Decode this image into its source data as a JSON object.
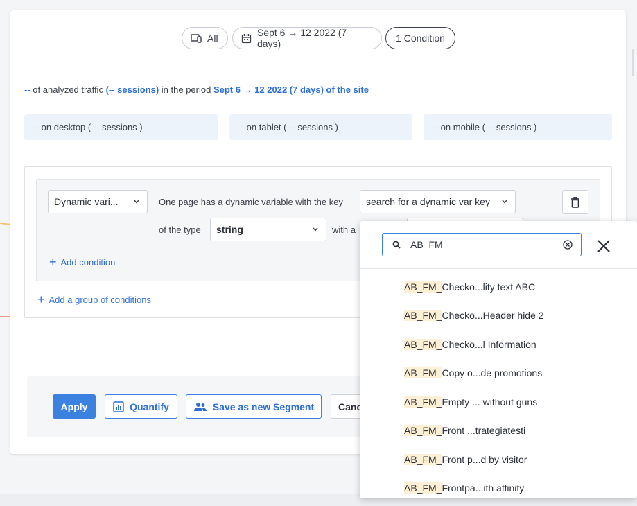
{
  "filters": {
    "device_label": "All",
    "date_label": "Sept 6 → 12 2022 (7 days)",
    "condition_label": "1 Condition"
  },
  "summary": {
    "count": "--",
    "text1": "of analyzed traffic",
    "sessions": "(-- sessions)",
    "text2": "in the period",
    "period": "Sept 6 → 12 2022 (7 days) of the site"
  },
  "devices": [
    {
      "count": "--",
      "label": "on desktop ( -- sessions )"
    },
    {
      "count": "--",
      "label": "on tablet ( -- sessions )"
    },
    {
      "count": "--",
      "label": "on mobile ( -- sessions )"
    }
  ],
  "condition": {
    "type_select": "Dynamic vari...",
    "sentence1": "One page has a dynamic variable with the key",
    "key_select": "search for a dynamic var key",
    "sentence2": "of the type",
    "type_value": "string",
    "sentence3": "with a",
    "add_condition": "Add condition",
    "add_group": "Add a group of conditions"
  },
  "actions": {
    "apply": "Apply",
    "quantify": "Quantify",
    "save_segment": "Save as new Segment",
    "cancel": "Canc"
  },
  "dropdown": {
    "search_value": "AB_FM_",
    "options": [
      {
        "match": "AB_FM_",
        "rest": "Checko...lity text ABC"
      },
      {
        "match": "AB_FM_",
        "rest": "Checko...Header hide 2"
      },
      {
        "match": "AB_FM_",
        "rest": "Checko...l Information"
      },
      {
        "match": "AB_FM_",
        "rest": "Copy o...de promotions"
      },
      {
        "match": "AB_FM_",
        "rest": "Empty ... without guns"
      },
      {
        "match": "AB_FM_",
        "rest": "Front ...trategiatesti"
      },
      {
        "match": "AB_FM_",
        "rest": "Front p...d by visitor"
      },
      {
        "match": "AB_FM_",
        "rest": "Frontpa...ith affinity"
      }
    ]
  },
  "colors": {
    "accent": "#3b82e0",
    "link": "#2d6fd6",
    "highlight": "#fdf0d5"
  }
}
